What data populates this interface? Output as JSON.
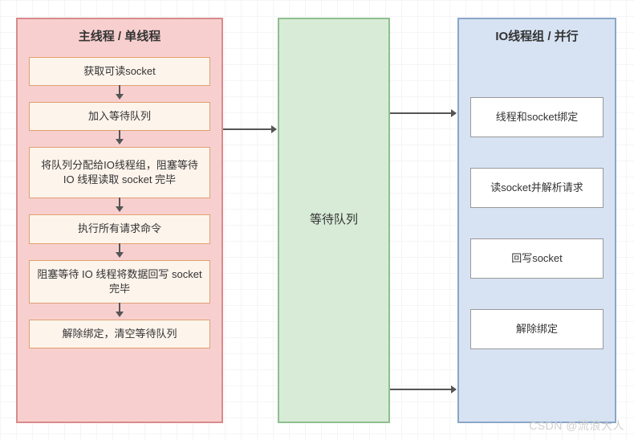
{
  "left": {
    "title": "主线程 / 单线程",
    "steps": [
      "获取可读socket",
      "加入等待队列",
      "将队列分配给IO线程组，阻塞等待 IO 线程读取 socket 完毕",
      "执行所有请求命令",
      "阻塞等待 IO 线程将数据回写 socket 完毕",
      "解除绑定，清空等待队列"
    ]
  },
  "mid": {
    "label": "等待队列"
  },
  "right": {
    "title": "IO线程组 / 并行",
    "steps": [
      "线程和socket绑定",
      "读socket并解析请求",
      "回写socket",
      "解除绑定"
    ]
  },
  "watermark": "CSDN @流浪大人"
}
